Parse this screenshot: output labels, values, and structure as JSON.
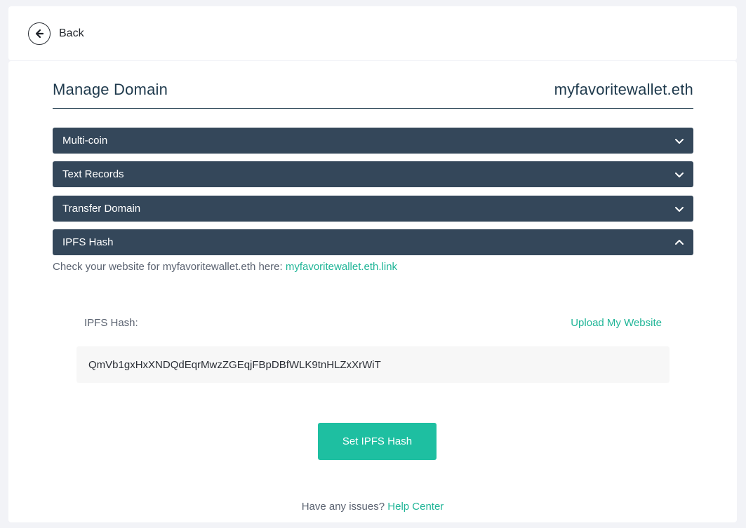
{
  "nav": {
    "back_label": "Back"
  },
  "header": {
    "title": "Manage Domain",
    "domain": "myfavoritewallet.eth"
  },
  "sections": [
    {
      "label": "Multi-coin",
      "expanded": false
    },
    {
      "label": "Text Records",
      "expanded": false
    },
    {
      "label": "Transfer Domain",
      "expanded": false
    },
    {
      "label": "IPFS Hash",
      "expanded": true
    }
  ],
  "ipfs": {
    "check_text": "Check your website for myfavoritewallet.eth here:",
    "check_link": "myfavoritewallet.eth.link",
    "field_label": "IPFS Hash:",
    "upload_link": "Upload My Website",
    "hash_value": "QmVb1gxHxXNDQdEqrMwzZGEqjFBpDBfWLK9tnHLZxXrWiT",
    "submit_label": "Set IPFS Hash"
  },
  "footer": {
    "text": "Have any issues?",
    "link": "Help Center"
  },
  "colors": {
    "accent": "#1ebfa1",
    "accordion": "#34475a",
    "title": "#1f3a4d"
  }
}
